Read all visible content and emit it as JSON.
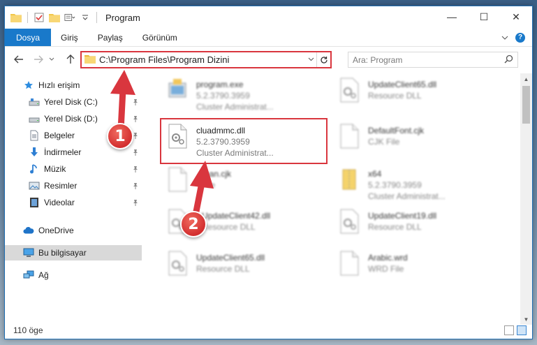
{
  "window": {
    "title": "Program",
    "controls": [
      "—",
      "☐",
      "✕"
    ]
  },
  "ribbon": {
    "tabs": [
      "Dosya",
      "Giriş",
      "Paylaş",
      "Görünüm"
    ]
  },
  "address": {
    "path": "C:\\Program Files\\Program Dizini",
    "search_placeholder": "Ara: Program"
  },
  "sidebar": {
    "items": [
      {
        "label": "Hızlı erişim",
        "icon": "star-icon"
      },
      {
        "label": "Yerel Disk (C:)",
        "icon": "drive-icon",
        "pinned": true
      },
      {
        "label": "Yerel Disk (D:)",
        "icon": "drive-icon",
        "pinned": true
      },
      {
        "label": "Belgeler",
        "icon": "document-icon",
        "pinned": true
      },
      {
        "label": "İndirmeler",
        "icon": "download-icon",
        "pinned": true
      },
      {
        "label": "Müzik",
        "icon": "music-icon",
        "pinned": true
      },
      {
        "label": "Resimler",
        "icon": "pictures-icon",
        "pinned": true
      },
      {
        "label": "Videolar",
        "icon": "video-icon",
        "pinned": true
      },
      {
        "label": "OneDrive",
        "icon": "cloud-icon"
      },
      {
        "label": "Bu bilgisayar",
        "icon": "computer-icon",
        "selected": true
      },
      {
        "label": "Ağ",
        "icon": "network-icon"
      }
    ]
  },
  "files": [
    {
      "name": "program.exe",
      "line2": "5.2.3790.3959",
      "line3": "Cluster Administrat...",
      "type": "exe"
    },
    {
      "name": "UpdateClient65.dll",
      "line2": "Resource DLL",
      "line3": "",
      "type": "dll"
    },
    {
      "name": "cluadmmc.dll",
      "line2": "5.2.3790.3959",
      "line3": "Cluster Administrat...",
      "type": "dll",
      "highlighted": true
    },
    {
      "name": "DefaultFont.cjk",
      "line2": "CJK File",
      "line3": "",
      "type": "file"
    },
    {
      "name": "rean.cjk",
      "line2": "File",
      "line3": "",
      "type": "file"
    },
    {
      "name": "x64",
      "line2": "5.2.3790.3959",
      "line3": "Cluster Administrat...",
      "type": "zip"
    },
    {
      "name": "UpdateClient42.dll",
      "line2": "Resource DLL",
      "line3": "",
      "type": "dll"
    },
    {
      "name": "UpdateClient19.dll",
      "line2": "Resource DLL",
      "line3": "",
      "type": "dll"
    },
    {
      "name": "UpdateClient65.dll",
      "line2": "Resource DLL",
      "line3": "",
      "type": "dll"
    },
    {
      "name": "Arabic.wrd",
      "line2": "WRD File",
      "line3": "",
      "type": "file"
    }
  ],
  "status": {
    "count": "110 öge"
  },
  "annotations": {
    "marker1": "1",
    "marker2": "2",
    "color": "#d9363e"
  }
}
